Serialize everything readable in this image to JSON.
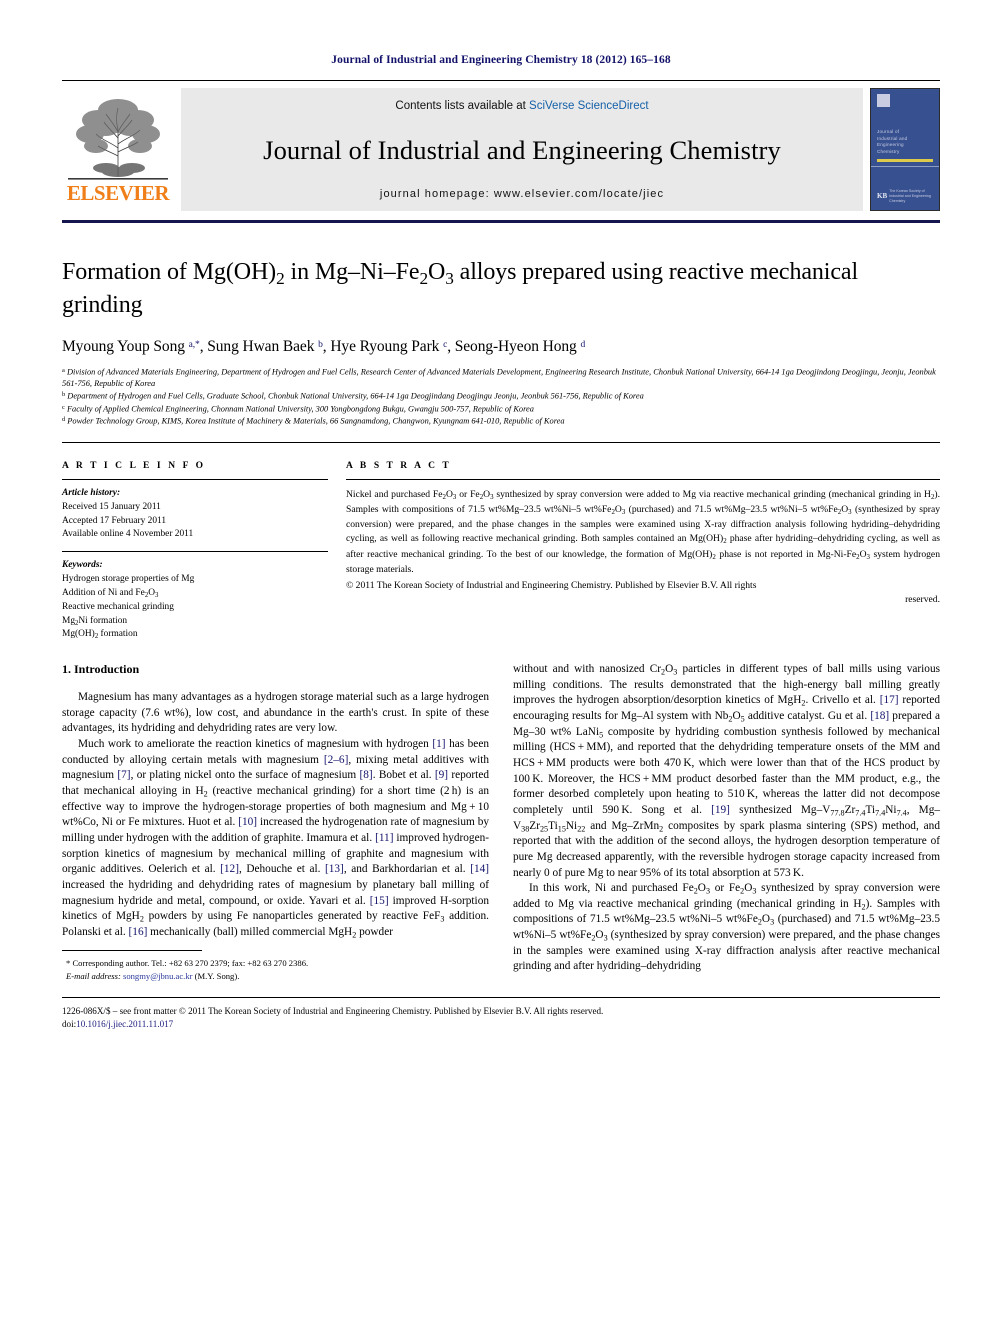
{
  "running_head": "Journal of Industrial and Engineering Chemistry 18 (2012) 165–168",
  "masthead": {
    "contents_prefix": "Contents lists available at ",
    "contents_link": "SciVerse ScienceDirect",
    "journal_title": "Journal of Industrial and Engineering Chemistry",
    "homepage": "journal homepage: www.elsevier.com/locate/jiec",
    "publisher_wordmark": "ELSEVIER",
    "cover": {
      "title_lines": "Journal of\nIndustrial and\nEngineering\nChemistry",
      "footer_text": "The Korean Society of\nIndustrial and Engineering Chemistry",
      "footer_mark": "KB"
    }
  },
  "article": {
    "title": "Formation of Mg(OH)2 in Mg–Ni–Fe2O3 alloys prepared using reactive mechanical grinding",
    "authors": "Myoung Youp Song a,*, Sung Hwan Baek b, Hye Ryoung Park c, Seong-Hyeon Hong d",
    "affiliations": [
      "a Division of Advanced Materials Engineering, Department of Hydrogen and Fuel Cells, Research Center of Advanced Materials Development, Engineering Research Institute, Chonbuk National University, 664-14 1ga Deogjindong Deogjingu, Jeonju, Jeonbuk 561-756, Republic of Korea",
      "b Department of Hydrogen and Fuel Cells, Graduate School, Chonbuk National University, 664-14 1ga Deogjindang Deogjingu Jeonju, Jeonbuk 561-756, Republic of Korea",
      "c Faculty of Applied Chemical Engineering, Chonnam National University, 300 Yongbongdong Bukgu, Gwangju 500-757, Republic of Korea",
      "d Powder Technology Group, KIMS, Korea Institute of Machinery & Materials, 66 Sangnamdong, Changwon, Kyungnam 641-010, Republic of Korea"
    ]
  },
  "article_info": {
    "heading": "A R T I C L E  I N F O",
    "history_label": "Article history:",
    "history": [
      "Received 15 January 2011",
      "Accepted 17 February 2011",
      "Available online 4 November 2011"
    ],
    "keywords_label": "Keywords:",
    "keywords": [
      "Hydrogen storage properties of Mg",
      "Addition of Ni and Fe2O3",
      "Reactive mechanical grinding",
      "Mg2Ni formation",
      "Mg(OH)2 formation"
    ]
  },
  "abstract": {
    "heading": "A B S T R A C T",
    "body": "Nickel and purchased Fe2O3 or Fe2O3 synthesized by spray conversion were added to Mg via reactive mechanical grinding (mechanical grinding in H2). Samples with compositions of 71.5 wt%Mg–23.5 wt%Ni–5 wt%Fe2O3 (purchased) and 71.5 wt%Mg–23.5 wt%Ni–5 wt%Fe2O3 (synthesized by spray conversion) were prepared, and the phase changes in the samples were examined using X-ray diffraction analysis following hydriding–dehydriding cycling, as well as following reactive mechanical grinding. Both samples contained an Mg(OH)2 phase after hydriding–dehydriding cycling, as well as after reactive mechanical grinding. To the best of our knowledge, the formation of Mg(OH)2 phase is not reported in Mg-Ni-Fe2O3 system hydrogen storage materials.",
    "copyright": "© 2011 The Korean Society of Industrial and Engineering Chemistry. Published by Elsevier B.V. All rights",
    "copyright_tail": "reserved."
  },
  "body": {
    "section_heading": "1. Introduction",
    "left_paragraphs": [
      "Magnesium has many advantages as a hydrogen storage material such as a large hydrogen storage capacity (7.6 wt%), low cost, and abundance in the earth's crust. In spite of these advantages, its hydriding and dehydriding rates are very low.",
      "Much work to ameliorate the reaction kinetics of magnesium with hydrogen [1] has been conducted by alloying certain metals with magnesium [2–6], mixing metal additives with magnesium [7], or plating nickel onto the surface of magnesium [8]. Bobet et al. [9] reported that mechanical alloying in H2 (reactive mechanical grinding) for a short time (2 h) is an effective way to improve the hydrogen-storage properties of both magnesium and Mg + 10 wt%Co, Ni or Fe mixtures. Huot et al. [10] increased the hydrogenation rate of magnesium by milling under hydrogen with the addition of graphite. Imamura et al. [11] improved hydrogen-sorption kinetics of magnesium by mechanical milling of graphite and magnesium with organic additives. Oelerich et al. [12], Dehouche et al. [13], and Barkhordarian et al. [14] increased the hydriding and dehydriding rates of magnesium by planetary ball milling of magnesium hydride and metal, compound, or oxide. Yavari et al. [15] improved H-sorption kinetics of MgH2 powders by using Fe nanoparticles generated by reactive FeF3 addition. Polanski et al. [16] mechanically (ball) milled commercial MgH2 powder"
    ],
    "right_paragraphs": [
      "without and with nanosized Cr2O3 particles in different types of ball mills using various milling conditions. The results demonstrated that the high-energy ball milling greatly improves the hydrogen absorption/desorption kinetics of MgH2. Crivello et al. [17] reported encouraging results for Mg–Al system with Nb2O5 additive catalyst. Gu et al. [18] prepared a Mg–30 wt% LaNi5 composite by hydriding combustion synthesis followed by mechanical milling (HCS + MM), and reported that the dehydriding temperature onsets of the MM and HCS + MM products were both 470 K, which were lower than that of the HCS product by 100 K. Moreover, the HCS + MM product desorbed faster than the MM product, e.g., the former desorbed completely upon heating to 510 K, whereas the latter did not decompose completely until 590 K. Song et al. [19] synthesized Mg–V77.8Zr7.4Ti7.4Ni7.4, Mg–V38Zr25Ti15Ni22 and Mg–ZrMn2 composites by spark plasma sintering (SPS) method, and reported that with the addition of the second alloys, the hydrogen desorption temperature of pure Mg decreased apparently, with the reversible hydrogen storage capacity increased from nearly 0 of pure Mg to near 95% of its total absorption at 573 K.",
      "In this work, Ni and purchased Fe2O3 or Fe2O3 synthesized by spray conversion were added to Mg via reactive mechanical grinding (mechanical grinding in H2). Samples with compositions of 71.5 wt%Mg–23.5 wt%Ni–5 wt%Fe2O3 (purchased) and 71.5 wt%Mg–23.5 wt%Ni–5 wt%Fe2O3 (synthesized by spray conversion) were prepared, and the phase changes in the samples were examined using X-ray diffraction analysis after reactive mechanical grinding and after hydriding–dehydriding"
    ]
  },
  "footnotes": {
    "corresponding": "* Corresponding author. Tel.: +82 63 270 2379; fax: +82 63 270 2386.",
    "email_label": "E-mail address:",
    "email": "songmy@jbnu.ac.kr",
    "email_suffix": " (M.Y. Song)."
  },
  "colophon": {
    "line1": "1226-086X/$ – see front matter © 2011 The Korean Society of Industrial and Engineering Chemistry. Published by Elsevier B.V. All rights reserved.",
    "doi_label": "doi:",
    "doi": "10.1016/j.jiec.2011.11.017"
  },
  "colors": {
    "running_head": "#13126b",
    "link": "#1560a8",
    "reference": "#13126b",
    "elsevier_orange": "#f07f1a",
    "rule_navy": "#16164f",
    "cover_blue": "#37508f"
  }
}
